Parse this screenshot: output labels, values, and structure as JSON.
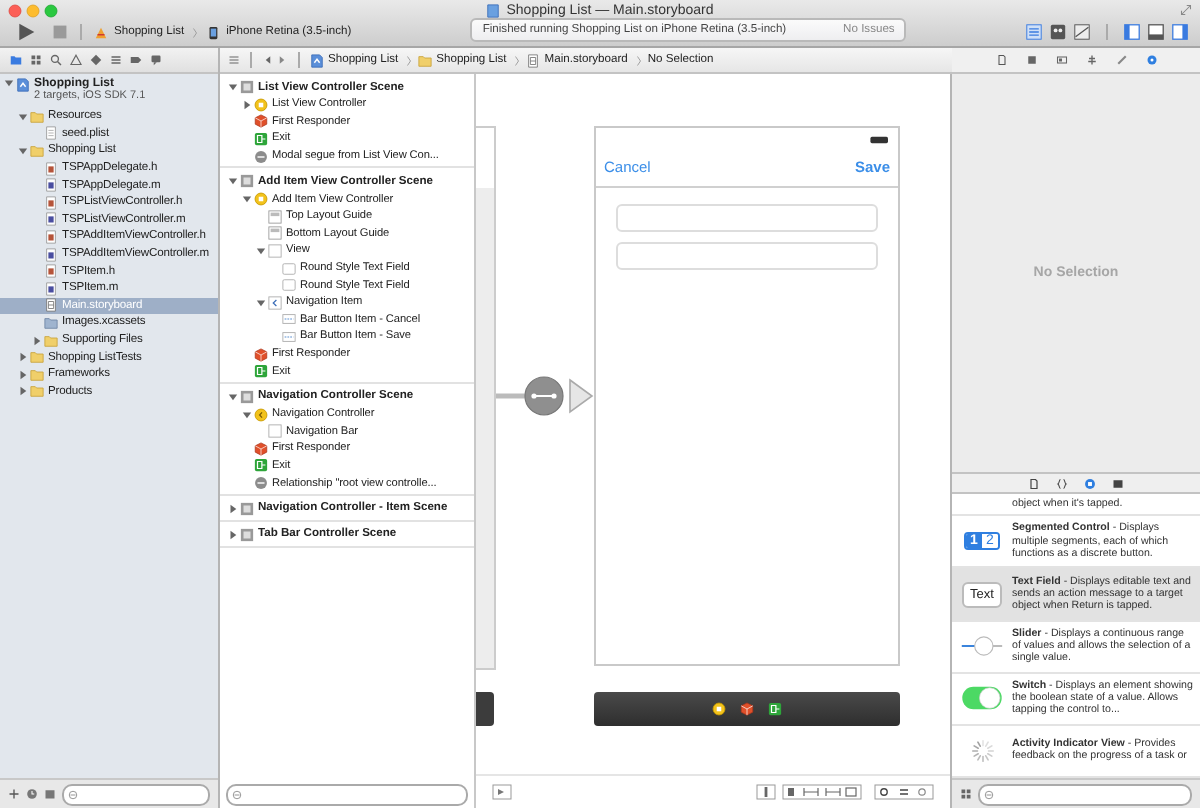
{
  "window": {
    "title": "Shopping List — Main.storyboard"
  },
  "toolbar": {
    "scheme": "Shopping List",
    "destination": "iPhone Retina (3.5-inch)",
    "activity": "Finished running Shopping List on iPhone Retina (3.5-inch)",
    "issues": "No Issues"
  },
  "jump_bar": [
    "Shopping List",
    "Shopping List",
    "Main.storyboard",
    "No Selection"
  ],
  "navigator": {
    "tree": [
      {
        "kind": "project",
        "name": "Shopping List",
        "subtitle": "2 targets, iOS SDK 7.1",
        "expanded": true,
        "selected": false,
        "children": [
          {
            "kind": "folder",
            "name": "Resources",
            "expanded": true,
            "selected": false,
            "children": [
              {
                "kind": "plist",
                "name": "seed.plist",
                "selected": false
              }
            ]
          },
          {
            "kind": "folder",
            "name": "Shopping List",
            "expanded": true,
            "selected": false,
            "children": [
              {
                "kind": "header",
                "name": "TSPAppDelegate.h",
                "selected": false
              },
              {
                "kind": "impl",
                "name": "TSPAppDelegate.m",
                "selected": false
              },
              {
                "kind": "header",
                "name": "TSPListViewController.h",
                "selected": false
              },
              {
                "kind": "impl",
                "name": "TSPListViewController.m",
                "selected": false
              },
              {
                "kind": "header",
                "name": "TSPAddItemViewController.h",
                "selected": false
              },
              {
                "kind": "impl",
                "name": "TSPAddItemViewController.m",
                "selected": false
              },
              {
                "kind": "header",
                "name": "TSPItem.h",
                "selected": false
              },
              {
                "kind": "impl",
                "name": "TSPItem.m",
                "selected": false
              },
              {
                "kind": "storyboard",
                "name": "Main.storyboard",
                "selected": true
              },
              {
                "kind": "assets",
                "name": "Images.xcassets",
                "selected": false
              },
              {
                "kind": "folder",
                "name": "Supporting Files",
                "expanded": false,
                "selected": false
              }
            ]
          },
          {
            "kind": "folder",
            "name": "Shopping ListTests",
            "expanded": false,
            "selected": false
          },
          {
            "kind": "folder",
            "name": "Frameworks",
            "expanded": false,
            "selected": false
          },
          {
            "kind": "folder",
            "name": "Products",
            "expanded": false,
            "selected": false
          }
        ]
      }
    ]
  },
  "outline": {
    "scenes": [
      {
        "name": "List View Controller Scene",
        "expanded": true,
        "children": [
          {
            "kind": "controller",
            "name": "List View Controller",
            "expanded": false
          },
          {
            "kind": "responder",
            "name": "First Responder"
          },
          {
            "kind": "exit",
            "name": "Exit"
          },
          {
            "kind": "segue",
            "name": "Modal segue from List View Con..."
          }
        ]
      },
      {
        "name": "Add Item View Controller Scene",
        "expanded": true,
        "children": [
          {
            "kind": "controller",
            "name": "Add Item View Controller",
            "expanded": true,
            "children": [
              {
                "kind": "guide",
                "name": "Top Layout Guide"
              },
              {
                "kind": "guide",
                "name": "Bottom Layout Guide"
              },
              {
                "kind": "view",
                "name": "View",
                "expanded": true,
                "children": [
                  {
                    "kind": "textfield",
                    "name": "Round Style Text Field"
                  },
                  {
                    "kind": "textfield",
                    "name": "Round Style Text Field"
                  }
                ]
              },
              {
                "kind": "navitem",
                "name": "Navigation Item",
                "expanded": true,
                "children": [
                  {
                    "kind": "barbutton",
                    "name": "Bar Button Item - Cancel"
                  },
                  {
                    "kind": "barbutton",
                    "name": "Bar Button Item - Save"
                  }
                ]
              }
            ]
          },
          {
            "kind": "responder",
            "name": "First Responder"
          },
          {
            "kind": "exit",
            "name": "Exit"
          }
        ]
      },
      {
        "name": "Navigation Controller Scene",
        "expanded": true,
        "children": [
          {
            "kind": "navcontroller",
            "name": "Navigation Controller",
            "expanded": true,
            "children": [
              {
                "kind": "navbar",
                "name": "Navigation Bar"
              }
            ]
          },
          {
            "kind": "responder",
            "name": "First Responder"
          },
          {
            "kind": "exit",
            "name": "Exit"
          },
          {
            "kind": "segue",
            "name": "Relationship \"root view controlle..."
          }
        ]
      },
      {
        "name": "Navigation Controller - Item Scene",
        "expanded": false
      },
      {
        "name": "Tab Bar Controller Scene",
        "expanded": false
      }
    ]
  },
  "canvas": {
    "left_button": "Cancel",
    "right_button": "Save"
  },
  "inspector": {
    "message": "No Selection"
  },
  "library": {
    "items": [
      {
        "kind": "partial",
        "description": "object when it's tapped.",
        "selected": false
      },
      {
        "kind": "segmented",
        "icon_labels": [
          "1",
          "2"
        ],
        "description": "**Segmented Control** - Displays multiple segments, each of which functions as a discrete button.",
        "selected": false
      },
      {
        "kind": "textfield",
        "icon_label": "Text",
        "description": "**Text Field** - Displays editable text and sends an action message to a target object when Return is tapped.",
        "selected": true
      },
      {
        "kind": "slider",
        "description": "**Slider** - Displays a continuous range of values and allows the selection of a single value.",
        "selected": false
      },
      {
        "kind": "switch",
        "description": "**Switch** - Displays an element showing the boolean state of a value. Allows tapping the control to...",
        "selected": false
      },
      {
        "kind": "activity",
        "description": "**Activity Indicator View** - Provides feedback on the progress of a task or",
        "selected": false
      }
    ]
  }
}
